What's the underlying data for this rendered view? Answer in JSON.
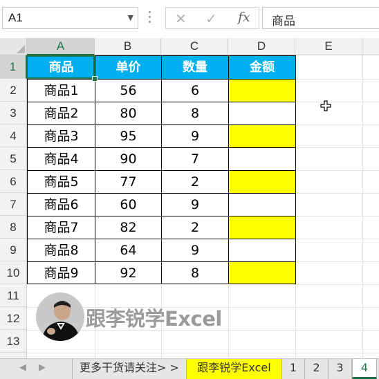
{
  "formula_bar": {
    "name_box": "A1",
    "cancel_glyph": "✕",
    "enter_glyph": "✓",
    "fx_label": "fx",
    "content": "商品"
  },
  "columns": [
    "A",
    "B",
    "C",
    "D",
    "E"
  ],
  "rows": [
    "1",
    "2",
    "3",
    "4",
    "5",
    "6",
    "7",
    "8",
    "9",
    "10",
    "11",
    "12",
    "13"
  ],
  "table": {
    "headers": [
      "商品",
      "单价",
      "数量",
      "金额"
    ],
    "rows": [
      [
        "商品1",
        "56",
        "6",
        ""
      ],
      [
        "商品2",
        "80",
        "8",
        ""
      ],
      [
        "商品3",
        "95",
        "9",
        ""
      ],
      [
        "商品4",
        "90",
        "7",
        ""
      ],
      [
        "商品5",
        "77",
        "2",
        ""
      ],
      [
        "商品6",
        "60",
        "9",
        ""
      ],
      [
        "商品7",
        "82",
        "2",
        ""
      ],
      [
        "商品8",
        "64",
        "9",
        ""
      ],
      [
        "商品9",
        "92",
        "8",
        ""
      ]
    ]
  },
  "colors": {
    "header_fill": "#00b0f0",
    "highlight_fill": "#ffff00",
    "selection": "#217346"
  },
  "logo": {
    "text": "跟李锐学Excel"
  },
  "sheet_tabs": {
    "tabs": [
      "更多干货请关注> >",
      "跟李锐学Excel",
      "1",
      "2",
      "3",
      "4"
    ],
    "active": "4"
  }
}
